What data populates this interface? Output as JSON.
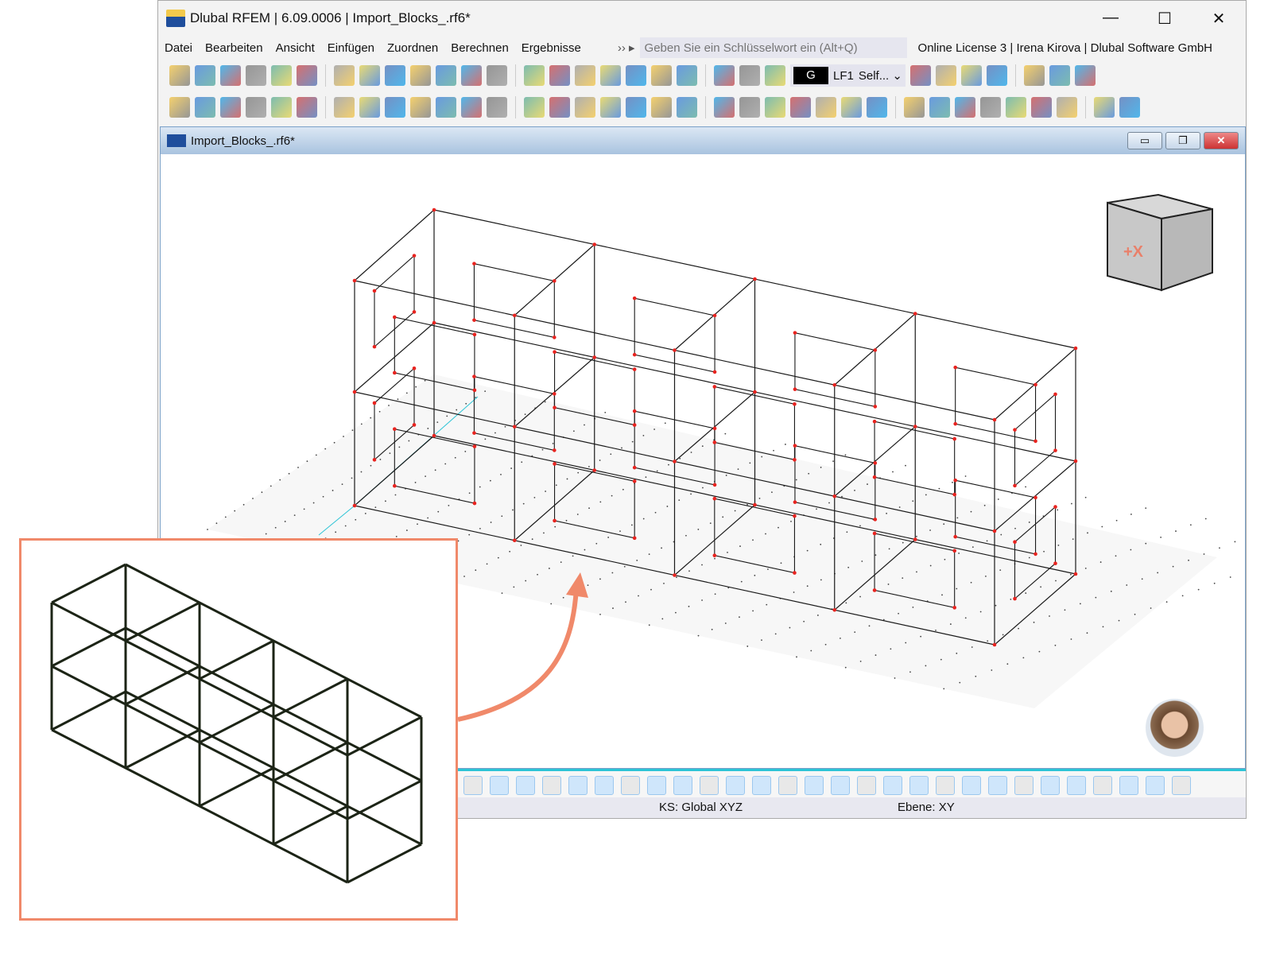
{
  "app": {
    "title": "Dlubal RFEM | 6.09.0006 | Import_Blocks_.rf6*",
    "window_controls": [
      "—",
      "☐",
      "✕"
    ]
  },
  "menu": {
    "items": [
      "Datei",
      "Bearbeiten",
      "Ansicht",
      "Einfügen",
      "Zuordnen",
      "Berechnen",
      "Ergebnisse"
    ],
    "more": "›› ▸",
    "search_placeholder": "Geben Sie ein Schlüsselwort ein (Alt+Q)",
    "license": "Online License 3 | Irena Kirova | Dlubal Software GmbH"
  },
  "toolbar": {
    "load_group": "G",
    "load_case": "LF1",
    "load_case_name": "Self...",
    "overflow": "»"
  },
  "document": {
    "title": "Import_Blocks_.rf6*",
    "controls": [
      "▭",
      "❐",
      "✕"
    ]
  },
  "navcube": {
    "label": "+X"
  },
  "statusbar": {
    "coordinate_system": "KS: Global XYZ",
    "plane": "Ebene: XY"
  },
  "colors": {
    "accent": "#f0896a",
    "node": "#e8231f",
    "member": "#1a1a1a",
    "mdi_title": "#a9c3df"
  }
}
